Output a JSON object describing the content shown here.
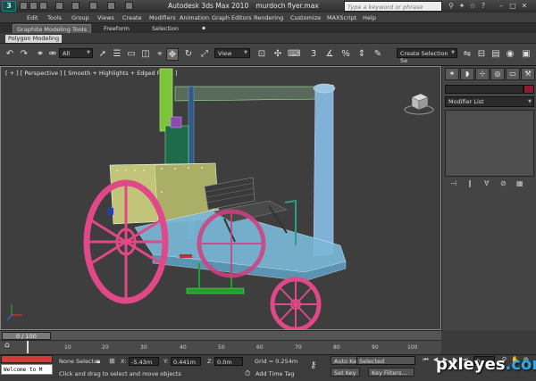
{
  "titlebar": {
    "app_name": "Autodesk 3ds Max 2010",
    "file_name": "murdoch flyer.max",
    "search_placeholder": "Type a keyword or phrase",
    "logo_icon": "3ds-max-logo-icon"
  },
  "menu": [
    "Edit",
    "Tools",
    "Group",
    "Views",
    "Create",
    "Modifiers",
    "Animation",
    "Graph Editors",
    "Rendering",
    "Customize",
    "MAXScript",
    "Help"
  ],
  "ribbon": {
    "tabs": [
      "Graphite Modeling Tools",
      "Freeform",
      "Selection"
    ],
    "active_tab": "Graphite Modeling Tools",
    "panel_label": "Polygon Modeling"
  },
  "toolbar": {
    "filter": "All",
    "ref_coord": "View",
    "named_selection": "Create Selection Se"
  },
  "viewport": {
    "label": "[ + ] [ Perspective ] [ Smooth + Highlights + Edged Faces ]"
  },
  "command_panel": {
    "modifier_list": "Modifier List",
    "object_color": "#8a1e2e"
  },
  "timeline": {
    "frame": "0 / 100",
    "ticks": [
      "10",
      "20",
      "30",
      "40",
      "50",
      "60",
      "70",
      "80",
      "90",
      "100"
    ]
  },
  "status": {
    "maxscript": "Welcome to M",
    "selection": "None Selecte",
    "prompt": "Click and drag to select and move objects",
    "x_label": "X:",
    "x_value": "-5.43m",
    "y_label": "Y:",
    "y_value": "0.441m",
    "z_label": "Z:",
    "z_value": "0.0m",
    "grid": "Grid = 0.254m",
    "add_time_tag": "Add Time Tag",
    "auto_key": "Auto Key",
    "set_key": "Set Key",
    "key_mode": "Selected",
    "key_filters": "Key Filters...",
    "frame_field": "0"
  },
  "watermark": {
    "brand": "pxleyes",
    "tld": ".com"
  }
}
